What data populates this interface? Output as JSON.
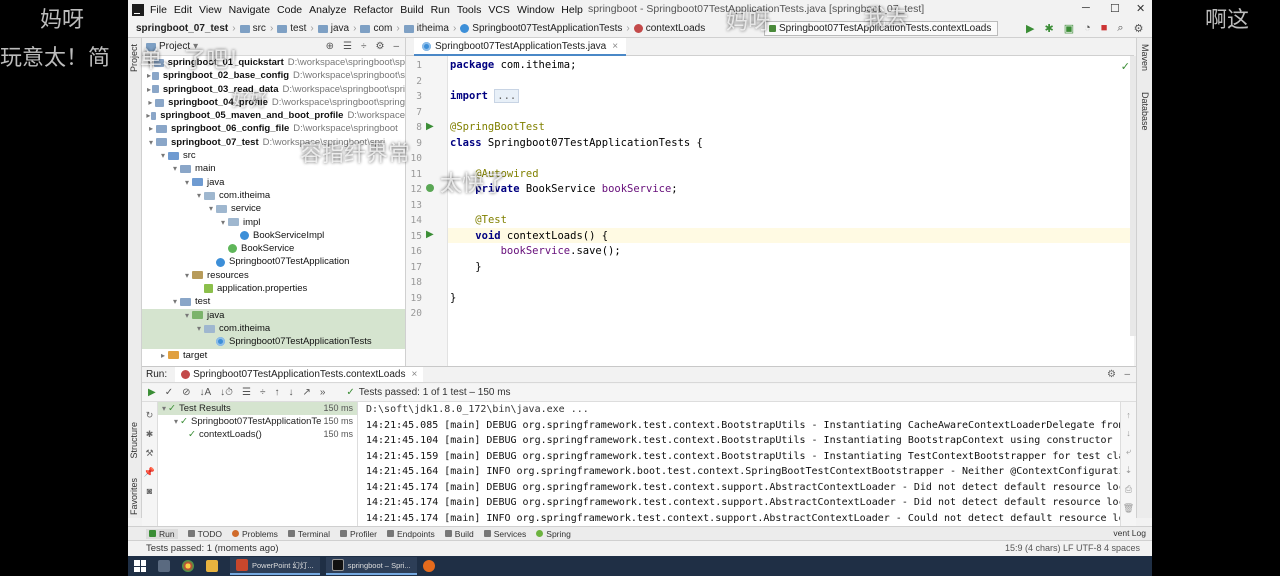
{
  "danmaku": {
    "left_top": "妈呀",
    "left_mid": "玩意太！简",
    "right_top": "啊这",
    "overlay_1": "妈呀",
    "overlay_2": "我去",
    "overlay_3": "单、了吧！",
    "overlay_4": "太快了",
    "overlay_5": "容指纤界常",
    "overlay_6": "好好"
  },
  "menu": {
    "items": [
      "File",
      "Edit",
      "View",
      "Navigate",
      "Code",
      "Analyze",
      "Refactor",
      "Build",
      "Run",
      "Tools",
      "VCS",
      "Window",
      "Help"
    ],
    "title": "springboot - Springboot07TestApplicationTests.java [springboot_07_test]"
  },
  "nav": {
    "crumbs": [
      "springboot_07_test",
      "src",
      "test",
      "java",
      "com",
      "itheima",
      "Springboot07TestApplicationTests",
      "contextLoads"
    ],
    "run_config": "Springboot07TestApplicationTests.contextLoads"
  },
  "project": {
    "title": "Project",
    "tree": [
      {
        "indent": 0,
        "arrow": "▸",
        "icon": "module",
        "name": "springboot_01_quickstart",
        "path": "D:\\workspace\\springboot\\sp",
        "bold": true
      },
      {
        "indent": 0,
        "arrow": "▸",
        "icon": "module",
        "name": "springboot_02_base_config",
        "path": "D:\\workspace\\springboot\\s",
        "bold": true
      },
      {
        "indent": 0,
        "arrow": "▸",
        "icon": "module",
        "name": "springboot_03_read_data",
        "path": "D:\\workspace\\springboot\\spri",
        "bold": true
      },
      {
        "indent": 0,
        "arrow": "▸",
        "icon": "module",
        "name": "springboot_04_profile",
        "path": "D:\\workspace\\springboot\\spring",
        "bold": true
      },
      {
        "indent": 0,
        "arrow": "▸",
        "icon": "module",
        "name": "springboot_05_maven_and_boot_profile",
        "path": "D:\\workspace",
        "bold": true
      },
      {
        "indent": 0,
        "arrow": "▸",
        "icon": "module",
        "name": "springboot_06_config_file",
        "path": "D:\\workspace\\springboot",
        "bold": true
      },
      {
        "indent": 0,
        "arrow": "▾",
        "icon": "module",
        "name": "springboot_07_test",
        "path": "D:\\workspace\\springboot\\spri",
        "bold": true
      },
      {
        "indent": 1,
        "arrow": "▾",
        "icon": "src",
        "name": "src",
        "path": "",
        "bold": false
      },
      {
        "indent": 2,
        "arrow": "▾",
        "icon": "folder",
        "name": "main",
        "path": "",
        "bold": false
      },
      {
        "indent": 3,
        "arrow": "▾",
        "icon": "src",
        "name": "java",
        "path": "",
        "bold": false
      },
      {
        "indent": 4,
        "arrow": "▾",
        "icon": "pkg",
        "name": "com.itheima",
        "path": "",
        "bold": false
      },
      {
        "indent": 5,
        "arrow": "▾",
        "icon": "pkg",
        "name": "service",
        "path": "",
        "bold": false
      },
      {
        "indent": 6,
        "arrow": "▾",
        "icon": "pkg",
        "name": "impl",
        "path": "",
        "bold": false
      },
      {
        "indent": 7,
        "arrow": "",
        "icon": "class",
        "name": "BookServiceImpl",
        "path": "",
        "bold": false
      },
      {
        "indent": 6,
        "arrow": "",
        "icon": "iface",
        "name": "BookService",
        "path": "",
        "bold": false
      },
      {
        "indent": 5,
        "arrow": "",
        "icon": "class",
        "name": "Springboot07TestApplication",
        "path": "",
        "bold": false
      },
      {
        "indent": 3,
        "arrow": "▾",
        "icon": "res",
        "name": "resources",
        "path": "",
        "bold": false
      },
      {
        "indent": 4,
        "arrow": "",
        "icon": "props",
        "name": "application.properties",
        "path": "",
        "bold": false
      },
      {
        "indent": 2,
        "arrow": "▾",
        "icon": "folder",
        "name": "test",
        "path": "",
        "bold": false
      },
      {
        "indent": 3,
        "arrow": "▾",
        "icon": "test",
        "name": "java",
        "path": "",
        "bold": false,
        "sel": true
      },
      {
        "indent": 4,
        "arrow": "▾",
        "icon": "pkg",
        "name": "com.itheima",
        "path": "",
        "bold": false,
        "sel": true
      },
      {
        "indent": 5,
        "arrow": "",
        "icon": "testclass",
        "name": "Springboot07TestApplicationTests",
        "path": "",
        "bold": false,
        "sel": true
      },
      {
        "indent": 1,
        "arrow": "▸",
        "icon": "tgt",
        "name": "target",
        "path": "",
        "bold": false
      }
    ]
  },
  "editor": {
    "tab": "Springboot07TestApplicationTests.java",
    "lines": [
      {
        "n": "1",
        "html": "<span class=\"kw\">package</span> com.itheima;"
      },
      {
        "n": "2",
        "html": ""
      },
      {
        "n": "3",
        "html": "<span class=\"kw\">import</span> <span class=\"fold\">...</span>"
      },
      {
        "n": "7",
        "html": ""
      },
      {
        "n": "8",
        "html": "<span class=\"ann\">@SpringBootTest</span>"
      },
      {
        "n": "9",
        "html": "<span class=\"kw\">class</span> Springboot07TestApplicationTests {"
      },
      {
        "n": "10",
        "html": ""
      },
      {
        "n": "11",
        "html": "    <span class=\"ann\">@Autowired</span>"
      },
      {
        "n": "12",
        "html": "    <span class=\"kw\">private</span> BookService <span class=\"fld-t\">bookService</span>;"
      },
      {
        "n": "13",
        "html": ""
      },
      {
        "n": "14",
        "html": "    <span class=\"ann\">@Test</span>"
      },
      {
        "n": "15",
        "html": "    <span class=\"kw\">void</span> contextLoads() {"
      },
      {
        "n": "16",
        "html": "        <span class=\"fld-t\">bookService</span>.save();"
      },
      {
        "n": "17",
        "html": "    }"
      },
      {
        "n": "18",
        "html": ""
      },
      {
        "n": "19",
        "html": "}"
      },
      {
        "n": "20",
        "html": ""
      }
    ]
  },
  "run": {
    "label": "Run:",
    "tab": "Springboot07TestApplicationTests.contextLoads",
    "passed_label": "Tests passed:",
    "passed_value": "1 of 1 test – 150 ms",
    "tree": [
      {
        "indent": 0,
        "name": "Test Results",
        "ms": "150 ms",
        "sel": true
      },
      {
        "indent": 1,
        "name": "Springboot07TestApplicationTe",
        "ms": "150 ms",
        "sel": false
      },
      {
        "indent": 2,
        "name": "contextLoads()",
        "ms": "150 ms",
        "sel": false
      }
    ],
    "console": [
      "D:\\soft\\jdk1.8.0_172\\bin\\java.exe ...",
      "14:21:45.085 [main] DEBUG org.springframework.test.context.BootstrapUtils - Instantiating CacheAwareContextLoaderDelegate from c",
      "14:21:45.104 [main] DEBUG org.springframework.test.context.BootstrapUtils - Instantiating BootstrapContext using constructor [pu",
      "14:21:45.159 [main] DEBUG org.springframework.test.context.BootstrapUtils - Instantiating TestContextBootstrapper for test class",
      "14:21:45.164 [main] INFO org.springframework.boot.test.context.SpringBootTestContextBootstrapper - Neither @ContextConfiguration",
      "14:21:45.174 [main] DEBUG org.springframework.test.context.support.AbstractContextLoader - Did not detect default resource locat",
      "14:21:45.174 [main] DEBUG org.springframework.test.context.support.AbstractContextLoader - Did not detect default resource locat",
      "14:21:45.174 [main] INFO org.springframework.test.context.support.AbstractContextLoader - Could not detect default resource loca"
    ]
  },
  "bottom": {
    "tools": [
      "Run",
      "TODO",
      "Problems",
      "Terminal",
      "Profiler",
      "Endpoints",
      "Build",
      "Services",
      "Spring"
    ],
    "event_log": "vent Log",
    "status": "Tests passed: 1 (moments ago)",
    "status_right": "15:9 (4 chars)  LF  UTF-8  4 spaces"
  },
  "taskbar": {
    "apps": [
      "PowerPoint 幻灯...",
      "springboot – Spri..."
    ]
  },
  "side_tabs": {
    "left": [
      "Project",
      "Structure",
      "Favorites"
    ],
    "right": [
      "Maven",
      "Database"
    ]
  }
}
